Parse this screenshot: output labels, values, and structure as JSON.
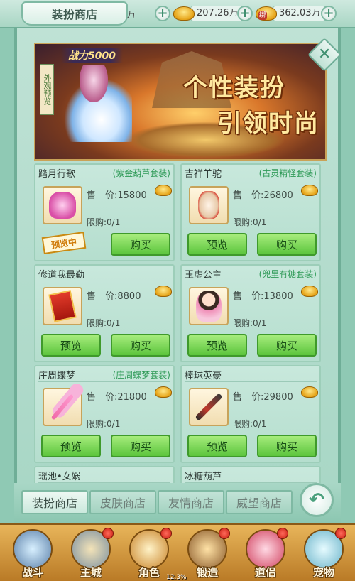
{
  "header": {
    "shop_title": "装扮商店",
    "partial_text": "万",
    "currency_gold": "207.26万",
    "currency_bound": "362.03万"
  },
  "banner": {
    "power_text": "战力5000",
    "stamp_text": "外观预览",
    "slogan_line1": "个性装扮",
    "slogan_line2": "引领时尚"
  },
  "items": [
    {
      "name": "踏月行歌",
      "set": "(紫金葫芦套装)",
      "price_label": "售",
      "price": "价:15800",
      "limit": "限购:0/1",
      "stamp": "预览中",
      "buy": "购买",
      "icon": "pink-outfit-icon"
    },
    {
      "name": "吉祥羊驼",
      "set": "(古灵精怪套装)",
      "price_label": "售",
      "price": "价:26800",
      "limit": "限购:0/1",
      "preview": "预览",
      "buy": "购买",
      "icon": "alpaca-icon"
    },
    {
      "name": "修道我最勤",
      "set": "",
      "price_label": "售",
      "price": "价:8800",
      "limit": "限购:0/1",
      "preview": "预览",
      "buy": "购买",
      "icon": "red-talisman-icon"
    },
    {
      "name": "玉虚公主",
      "set": "(兜里有糖套装)",
      "price_label": "售",
      "price": "价:13800",
      "limit": "限购:0/1",
      "preview": "预览",
      "buy": "购买",
      "icon": "princess-icon"
    },
    {
      "name": "庄周蝶梦",
      "set": "(庄周蝶梦套装)",
      "price_label": "售",
      "price": "价:21800",
      "limit": "限购:0/1",
      "preview": "预览",
      "buy": "购买",
      "icon": "butterfly-wand-icon"
    },
    {
      "name": "棒球英豪",
      "set": "",
      "price_label": "售",
      "price": "价:29800",
      "limit": "限购:0/1",
      "preview": "预览",
      "buy": "购买",
      "icon": "baseball-bat-icon"
    },
    {
      "name": "瑶池•女娲",
      "set": ""
    },
    {
      "name": "冰糖葫芦",
      "set": ""
    }
  ],
  "shop_tabs": [
    "装扮商店",
    "皮肤商店",
    "友情商店",
    "威望商店"
  ],
  "bottom_nav": [
    {
      "label": "战斗",
      "icon": "battle-icon",
      "dot": false
    },
    {
      "label": "主城",
      "icon": "main-city-icon",
      "dot": true
    },
    {
      "label": "角色",
      "icon": "character-icon",
      "dot": true
    },
    {
      "label": "锻造",
      "icon": "forge-icon",
      "dot": true
    },
    {
      "label": "道侣",
      "icon": "companion-icon",
      "dot": true
    },
    {
      "label": "宠物",
      "icon": "pet-icon",
      "dot": true
    }
  ],
  "xp_percent": "12.3%",
  "colors": {
    "accent_green": "#5cc53d",
    "panel": "#bfe2d5",
    "set_text": "#2e9a57",
    "gold": "#e6a419"
  }
}
